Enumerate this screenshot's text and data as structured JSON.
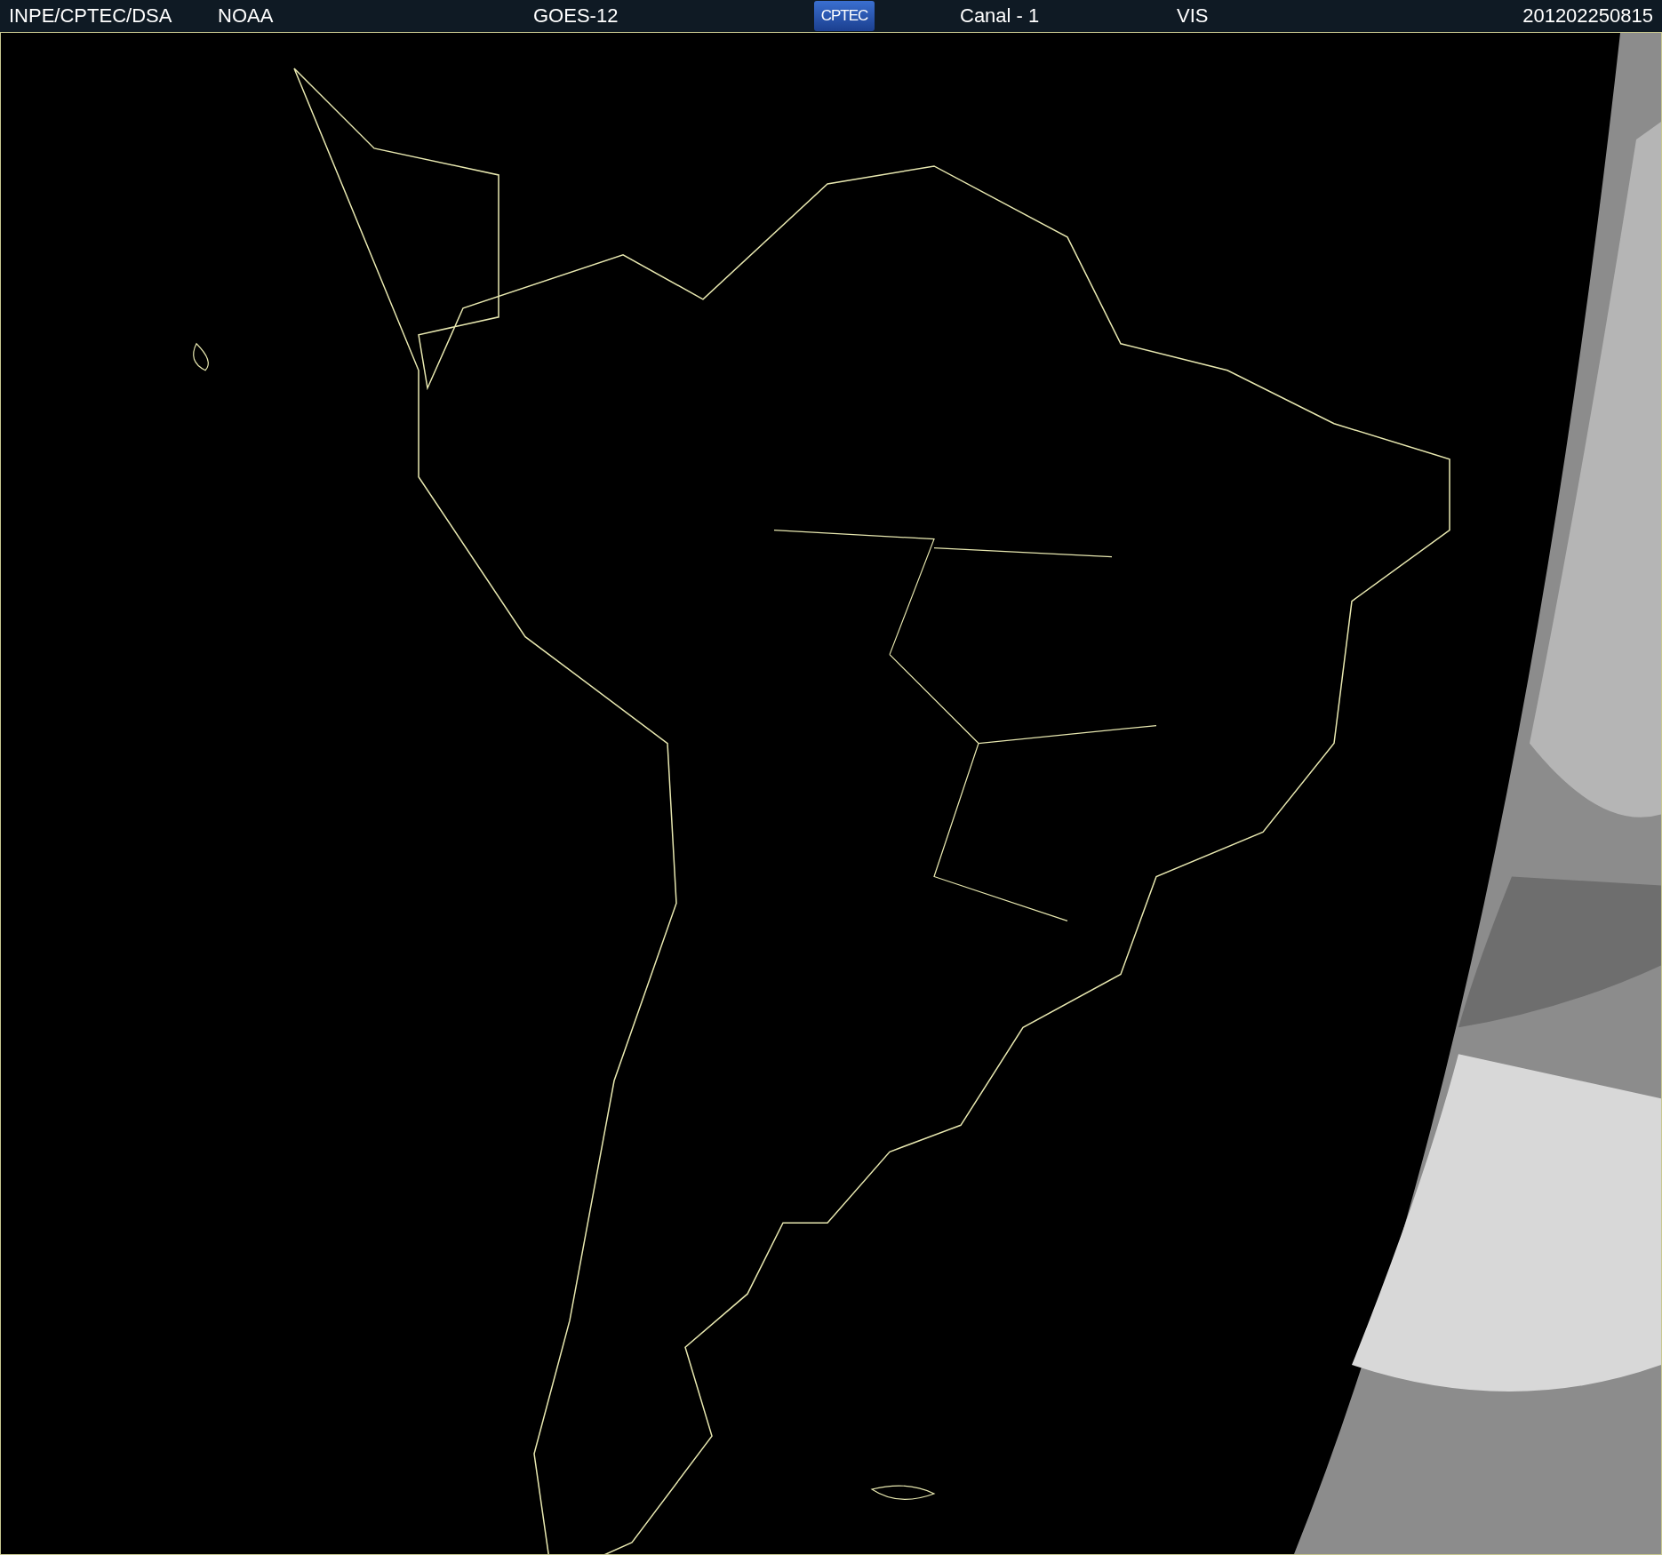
{
  "header": {
    "items": [
      {
        "kind": "text",
        "text": "INPE/CPTEC/DSA"
      },
      {
        "kind": "text",
        "text": "NOAA"
      },
      {
        "kind": "text",
        "text": "GOES-12"
      },
      {
        "kind": "logo",
        "text": "CPTEC"
      },
      {
        "kind": "text",
        "text": "Canal - 1"
      },
      {
        "kind": "text",
        "text": "VIS"
      },
      {
        "kind": "text",
        "text": "201202250815"
      }
    ]
  }
}
